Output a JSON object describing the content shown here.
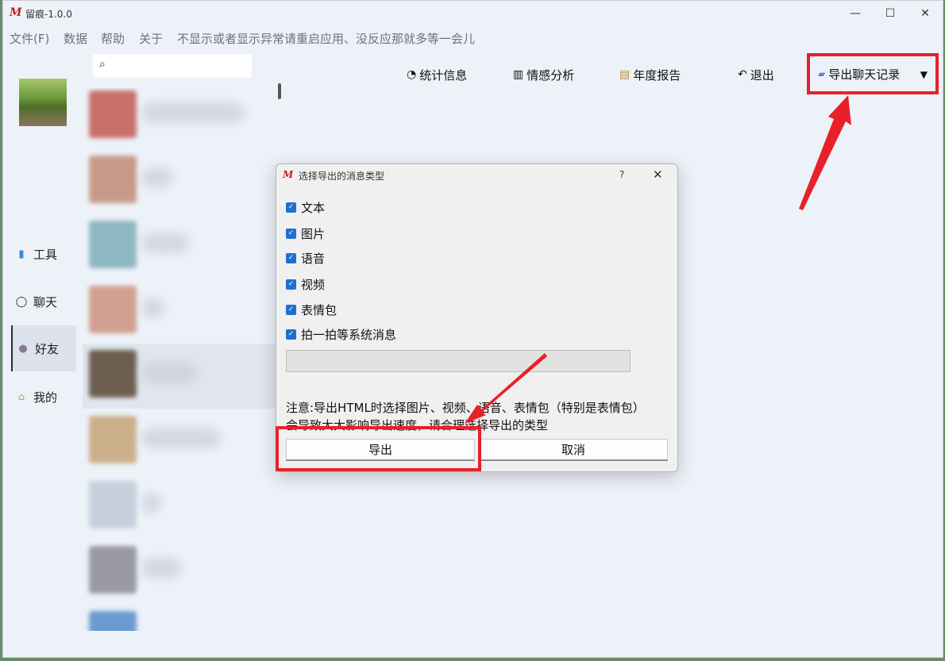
{
  "window": {
    "logo": "M",
    "title": "留痕-1.0.0",
    "min_glyph": "—",
    "max_glyph": "☐",
    "close_glyph": "✕"
  },
  "menu": [
    "文件(F)",
    "数据",
    "帮助",
    "关于",
    "不显示或者显示异常请重启应用、没反应那就多等一会儿"
  ],
  "nav": [
    {
      "label": "工具",
      "icon": "tools-icon",
      "glyph": "▮"
    },
    {
      "label": "聊天",
      "icon": "chat-icon",
      "glyph": "◯"
    },
    {
      "label": "好友",
      "icon": "friends-icon",
      "glyph": "●"
    },
    {
      "label": "我的",
      "icon": "home-icon",
      "glyph": "⌂"
    }
  ],
  "toolbar": {
    "stats": {
      "label": "统计信息",
      "glyph": "◔"
    },
    "sentiment": {
      "label": "情感分析",
      "glyph": "▥"
    },
    "annual": {
      "label": "年度报告",
      "glyph": "▤"
    },
    "logout": {
      "label": "退出",
      "glyph": "↶"
    },
    "export": {
      "label": "导出聊天记录",
      "glyph": "▰",
      "dropdown_glyph": "▼"
    }
  },
  "search": {
    "glyph": "⌕"
  },
  "dialog": {
    "logo": "M",
    "title": "选择导出的消息类型",
    "help_glyph": "?",
    "close_glyph": "✕",
    "options": [
      {
        "label": "文本",
        "checked": true
      },
      {
        "label": "图片",
        "checked": true
      },
      {
        "label": "语音",
        "checked": true
      },
      {
        "label": "视频",
        "checked": true
      },
      {
        "label": "表情包",
        "checked": true
      },
      {
        "label": "拍一拍等系统消息",
        "checked": true
      }
    ],
    "progress": 0,
    "note_line1": "注意:导出HTML时选择图片、视频、语音、表情包（特别是表情包）",
    "note_line2": "会导致大大影响导出速度，请合理选择导出的类型",
    "export_label": "导出",
    "cancel_label": "取消"
  },
  "colors": {
    "highlight": "#e8202a",
    "accent": "#1f6fd1",
    "window_bg": "#edf2f9"
  }
}
